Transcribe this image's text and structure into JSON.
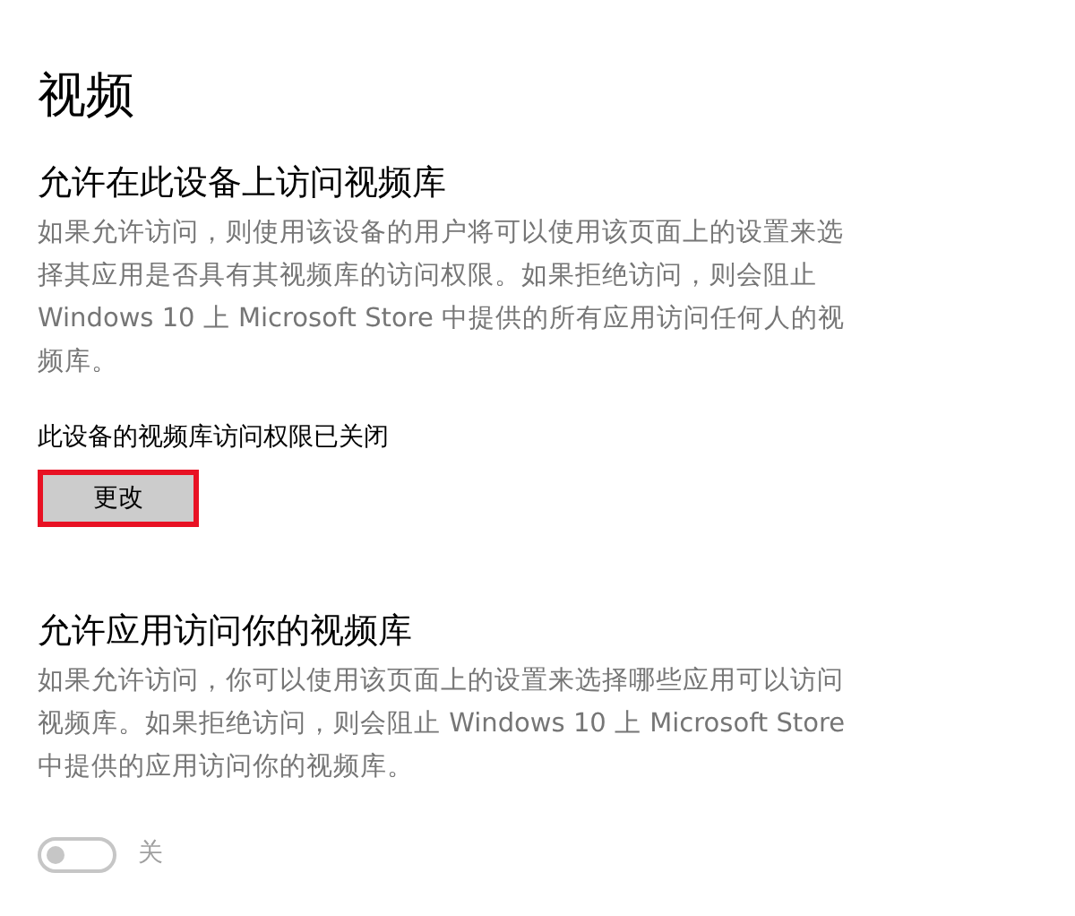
{
  "page_title": "视频",
  "sections": [
    {
      "heading": "允许在此设备上访问视频库",
      "description": "如果允许访问，则使用该设备的用户将可以使用该页面上的设置来选择其应用是否具有其视频库的访问权限。如果拒绝访问，则会阻止 Windows 10 上 Microsoft Store 中提供的所有应用访问任何人的视频库。",
      "kind": "button",
      "status": "此设备的视频库访问权限已关闭",
      "button": {
        "label": "更改",
        "highlighted": true
      }
    },
    {
      "heading": "允许应用访问你的视频库",
      "description": "如果允许访问，你可以使用该页面上的设置来选择哪些应用可以访问视频库。如果拒绝访问，则会阻止 Windows 10 上 Microsoft Store 中提供的应用访问你的视频库。",
      "kind": "toggle",
      "toggle": {
        "on": false,
        "disabled": true,
        "label": "关"
      }
    }
  ]
}
